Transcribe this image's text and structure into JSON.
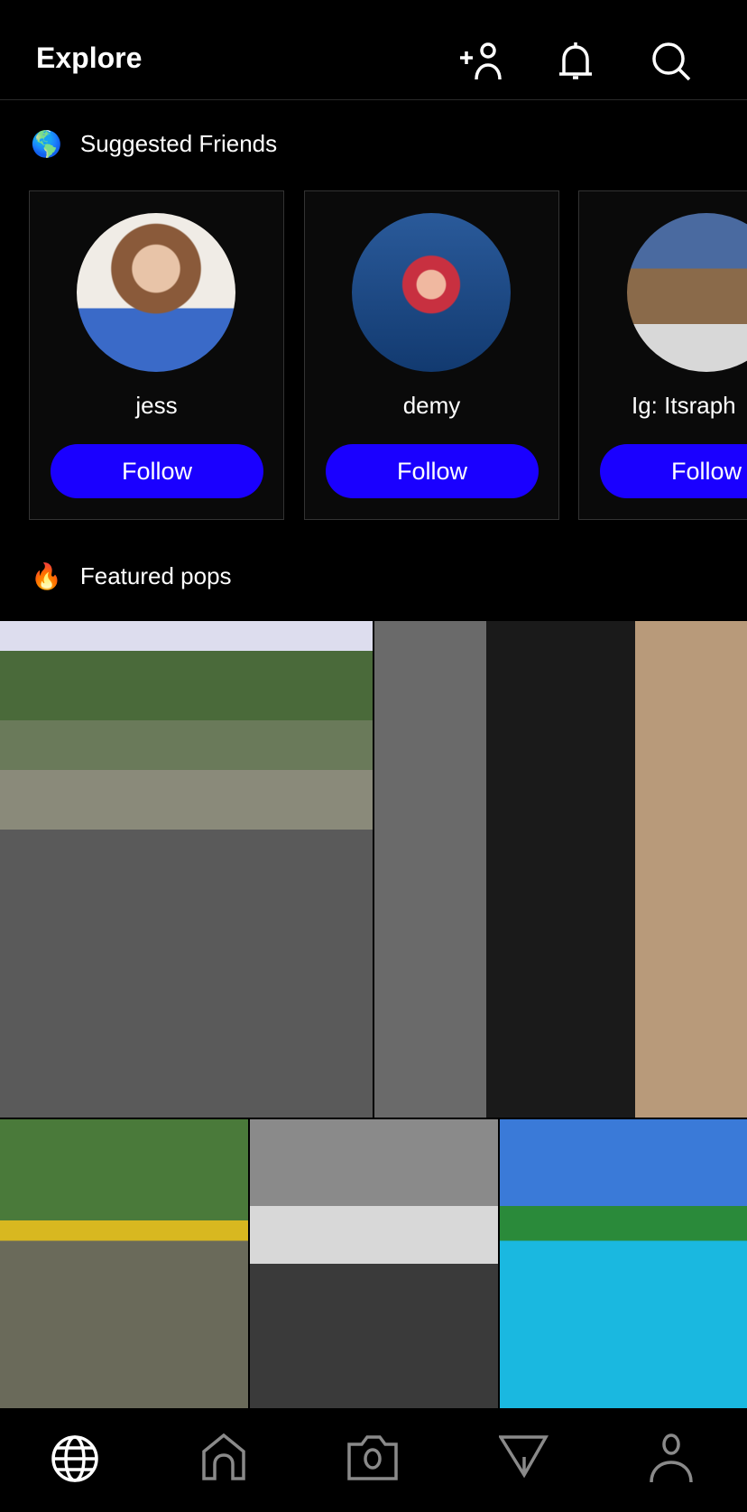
{
  "header": {
    "title": "Explore",
    "icons": [
      "add-friend-icon",
      "bell-icon",
      "search-icon"
    ]
  },
  "suggested": {
    "emoji": "🌎",
    "title": "Suggested Friends",
    "friends": [
      {
        "name": "jess",
        "follow": "Follow"
      },
      {
        "name": "demy",
        "follow": "Follow"
      },
      {
        "name": "Ig: Itsraph",
        "follow": "Follow"
      }
    ]
  },
  "featured": {
    "emoji": "🔥",
    "title": "Featured pops"
  },
  "colors": {
    "accent": "#1a00ff",
    "background": "#000000",
    "nav_active": "#ffffff",
    "nav_inactive": "#8a8a8a"
  },
  "nav": {
    "items": [
      "globe-icon",
      "home-icon",
      "camera-icon",
      "send-icon",
      "profile-icon"
    ],
    "active": "globe-icon"
  }
}
